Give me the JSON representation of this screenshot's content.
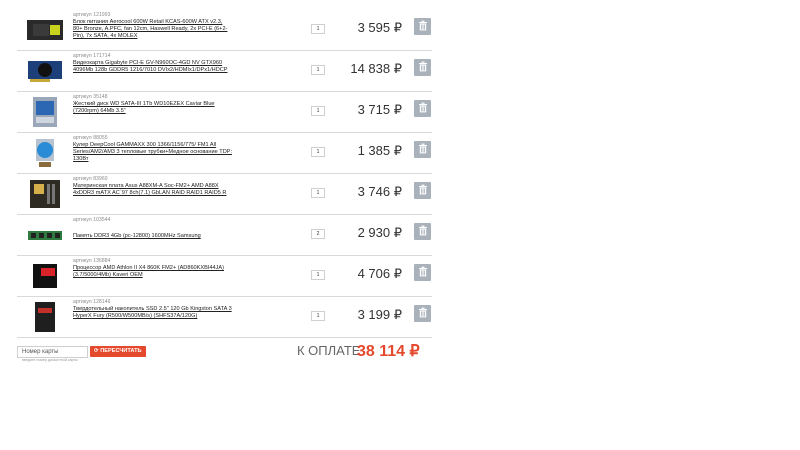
{
  "cart": {
    "items": [
      {
        "article": "артикул 121993",
        "title": "Блок питания Aerocool 600W Retail KCAS-600W ATX v2.3, 80+ Bronze, A.PFC, fan 12cm, Haswell Ready, 2x PCI-E (6+2-Pin), 7x SATA, 4x MOLEX",
        "qty": "1",
        "price": "3 595 ₽",
        "icon": "power-supply-icon"
      },
      {
        "article": "артикул 171714",
        "title": "Видеокарта Gigabyte PCI-E GV-N960OC-4GD NV GTX960 4096Mb 128b GDDR5 1216/7010 DVIx2/HDMIx1/DPx1/HDCP",
        "qty": "1",
        "price": "14 838 ₽",
        "icon": "video-card-icon"
      },
      {
        "article": "артикул 35148",
        "title": "Жесткий диск WD SATA-III 1Tb WD10EZEX Caviar Blue (7200rpm) 64Mb 3.5\"",
        "qty": "1",
        "price": "3 715 ₽",
        "icon": "hard-disk-icon"
      },
      {
        "article": "артикул 88055",
        "title": "Кулер DeepCool GAMMAXX 300 1366/1156/775/ FM1 All Series/AM2/AM3 3 тепловые трубки+Медное основание TDP: 130Вт",
        "qty": "1",
        "price": "1 385 ₽",
        "icon": "cooler-icon"
      },
      {
        "article": "артикул 83960",
        "title": "Материнская плата Asus A88XM-A Soc-FM2+ AMD A88X 4xDDR3 mATX AC`97 8ch(7.1) GbLAN RAID RAID1 RAID5 R",
        "qty": "1",
        "price": "3 746 ₽",
        "icon": "motherboard-icon"
      },
      {
        "article": "артикул 103544",
        "title": "Память DDR3 4Gb (pc-12800) 1600MHz Samsung",
        "qty": "2",
        "price": "2 930 ₽",
        "icon": "ram-icon",
        "single": true
      },
      {
        "article": "артикул 136884",
        "title": "Процессор AMD Athlon II X4 860K FM2+ (AD860KXBI44JA) (3.7/5000/4Mb) Kaveri OEM",
        "qty": "1",
        "price": "4 706 ₽",
        "icon": "cpu-icon"
      },
      {
        "article": "артикул 128146",
        "title": "Твердотельный накопитель SSD 2.5\" 120 Gb Kingston SATA 3 HyperX Fury (R500/W500MB/s) (SHFS37A/120G)",
        "qty": "1",
        "price": "3 199 ₽",
        "icon": "ssd-icon"
      }
    ]
  },
  "footer": {
    "card_placeholder": "Номер карты",
    "card_hint": "введите номер дисконтной карты",
    "recalc_label": "ПЕРЕСЧИТАТЬ",
    "total_label": "К ОПЛАТЕ",
    "total_value": "38 114 ₽"
  },
  "colors": {
    "accent": "#e5492d",
    "delete_button": "#a9b1bb",
    "divider": "#d9d9d9"
  }
}
